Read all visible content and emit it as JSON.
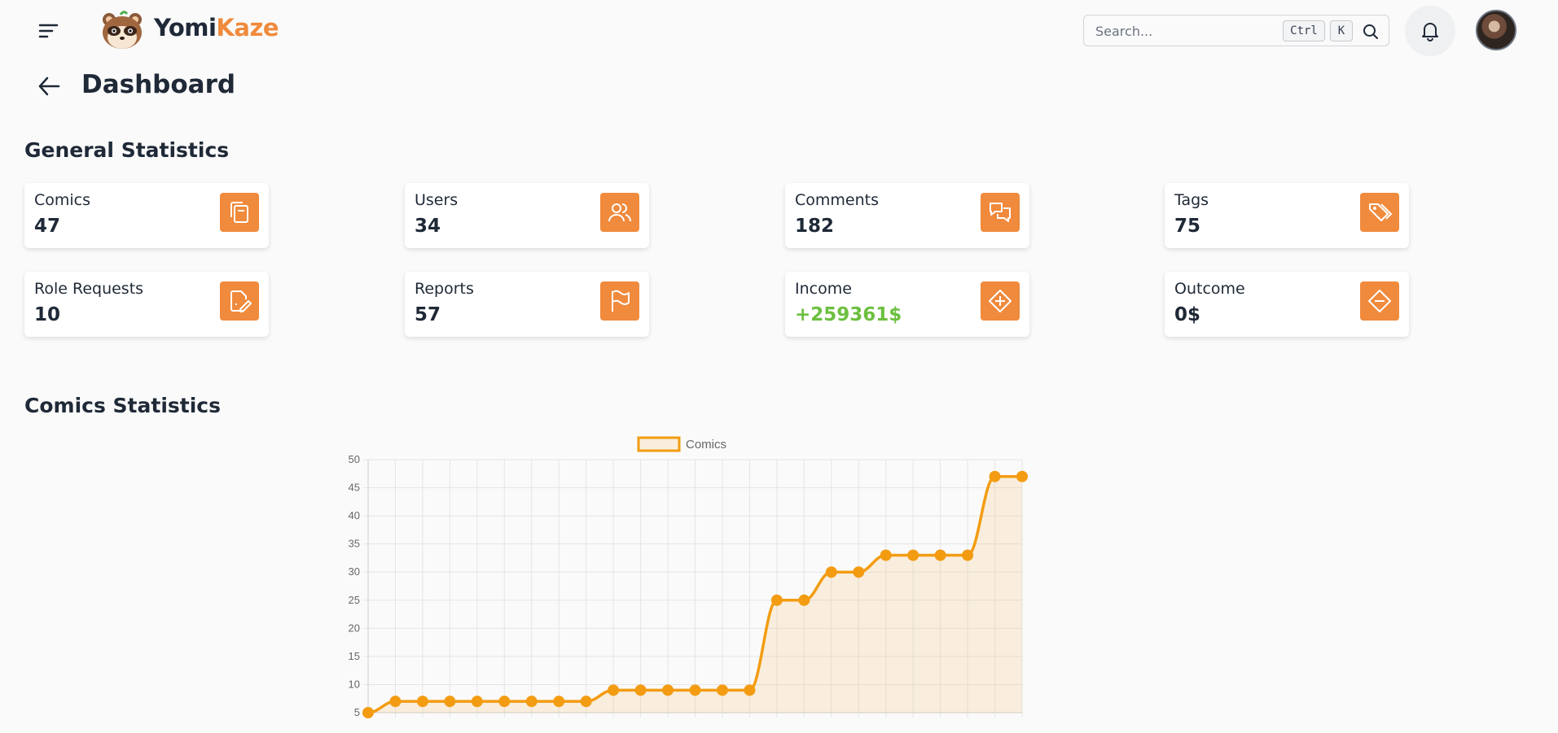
{
  "header": {
    "brand_part1": "Yomi",
    "brand_part2": "Kaze",
    "search_placeholder": "Search...",
    "shortcut_ctrl": "Ctrl",
    "shortcut_key": "K"
  },
  "page": {
    "title": "Dashboard"
  },
  "general": {
    "title": "General Statistics",
    "cards": [
      {
        "label": "Comics",
        "value": "47",
        "icon": "copy-icon"
      },
      {
        "label": "Users",
        "value": "34",
        "icon": "users-icon"
      },
      {
        "label": "Comments",
        "value": "182",
        "icon": "comments-icon"
      },
      {
        "label": "Tags",
        "value": "75",
        "icon": "tags-icon"
      },
      {
        "label": "Role Requests",
        "value": "10",
        "icon": "edit-document-icon"
      },
      {
        "label": "Reports",
        "value": "57",
        "icon": "flag-icon"
      },
      {
        "label": "Income",
        "value": "+259361$",
        "icon": "diamond-plus-icon"
      },
      {
        "label": "Outcome",
        "value": "0$",
        "icon": "diamond-minus-icon"
      }
    ]
  },
  "comics_section": {
    "title": "Comics Statistics"
  },
  "colors": {
    "accent": "#f08a3c",
    "chart_line": "#f39c12",
    "income_green": "#6cbf3f"
  },
  "chart_data": {
    "type": "line",
    "series": [
      {
        "name": "Comics",
        "values": [
          5,
          7,
          7,
          7,
          7,
          7,
          7,
          7,
          7,
          9,
          9,
          9,
          9,
          9,
          9,
          25,
          25,
          30,
          30,
          33,
          33,
          33,
          33,
          47,
          47
        ]
      }
    ],
    "y_ticks": [
      "50",
      "45",
      "40",
      "35",
      "30",
      "25",
      "20",
      "15",
      "10",
      "5"
    ],
    "ylim": [
      5,
      50
    ],
    "grid": true,
    "legend_position": "top"
  }
}
